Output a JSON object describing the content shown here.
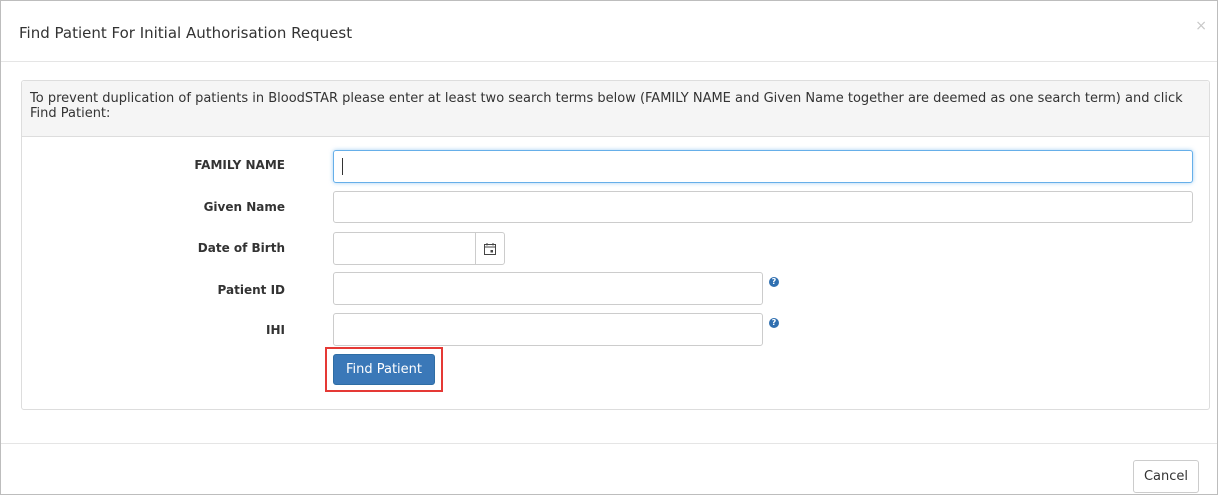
{
  "dialog": {
    "title": "Find Patient For Initial Authorisation Request",
    "close_glyph": "×"
  },
  "panel": {
    "instructions": "To prevent duplication of patients in BloodSTAR please enter at least two search terms below (FAMILY NAME and Given Name together are deemed as one search term) and click Find Patient:"
  },
  "form": {
    "family_name": {
      "label": "FAMILY NAME",
      "value": "",
      "placeholder": ""
    },
    "given_name": {
      "label": "Given Name",
      "value": "",
      "placeholder": ""
    },
    "dob": {
      "label": "Date of Birth",
      "value": "",
      "placeholder": "",
      "icon": "calendar-icon"
    },
    "patient_id": {
      "label": "Patient ID",
      "value": "",
      "placeholder": "",
      "help_icon": "question-circle-icon",
      "help_glyph": "?"
    },
    "ihi": {
      "label": "IHI",
      "value": "",
      "placeholder": "",
      "help_icon": "question-circle-icon",
      "help_glyph": "?"
    },
    "find_button": "Find Patient"
  },
  "footer": {
    "cancel_button": "Cancel"
  },
  "colors": {
    "primary_button": "#3a78b8",
    "highlight_border": "#e53935",
    "focus_border": "#66afe9",
    "help_icon": "#2f6fb0"
  }
}
